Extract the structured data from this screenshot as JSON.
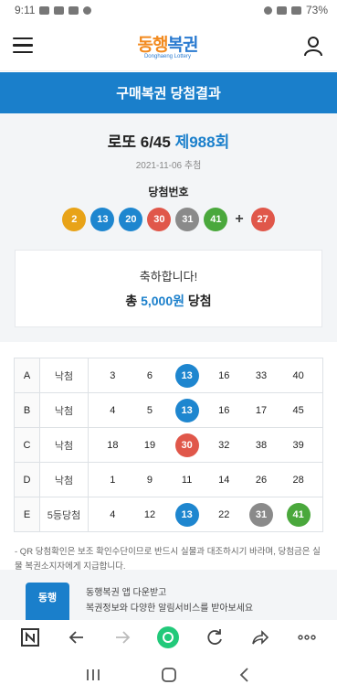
{
  "status": {
    "time": "9:11",
    "battery": "73%"
  },
  "header": {
    "logo_text_a": "동행",
    "logo_text_b": "복권",
    "logo_sub": "Donghaeng Lottery"
  },
  "title": "구매복권 당첨결과",
  "draw": {
    "game": "로또 6/45",
    "round": "제988회",
    "date": "2021-11-06 추첨",
    "win_label": "당첨번호",
    "numbers": [
      "2",
      "13",
      "20",
      "30",
      "31",
      "41"
    ],
    "bonus": "27",
    "ball_colors": [
      "#e8a318",
      "#1e86cf",
      "#1e86cf",
      "#e0574a",
      "#8a8a8a",
      "#4aa83c"
    ],
    "bonus_color": "#e0574a"
  },
  "result": {
    "message": "축하합니다!",
    "prize_prefix": "총",
    "prize_amount": "5,000원",
    "prize_suffix": "당첨"
  },
  "games": [
    {
      "id": "A",
      "result": "낙첨",
      "numbers": [
        "3",
        "6",
        "13",
        "16",
        "33",
        "40"
      ],
      "colors": [
        "",
        "",
        "#1e86cf",
        "",
        "",
        ""
      ]
    },
    {
      "id": "B",
      "result": "낙첨",
      "numbers": [
        "4",
        "5",
        "13",
        "16",
        "17",
        "45"
      ],
      "colors": [
        "",
        "",
        "#1e86cf",
        "",
        "",
        ""
      ]
    },
    {
      "id": "C",
      "result": "낙첨",
      "numbers": [
        "18",
        "19",
        "30",
        "32",
        "38",
        "39"
      ],
      "colors": [
        "",
        "",
        "#e0574a",
        "",
        "",
        ""
      ]
    },
    {
      "id": "D",
      "result": "낙첨",
      "numbers": [
        "1",
        "9",
        "11",
        "14",
        "26",
        "28"
      ],
      "colors": [
        "",
        "",
        "",
        "",
        "",
        ""
      ]
    },
    {
      "id": "E",
      "result": "5등당첨",
      "numbers": [
        "4",
        "12",
        "13",
        "22",
        "31",
        "41"
      ],
      "colors": [
        "",
        "",
        "#1e86cf",
        "",
        "#8a8a8a",
        "#4aa83c"
      ]
    }
  ],
  "note": "- QR 당첨확인은 보조 확인수단이므로 반드시 실물과 대조하시기 바라며, 당첨금은 실물 복권소지자에게 지급합니다.",
  "promo": {
    "line1": "동행복권 앱 다운받고",
    "line2": "복권정보와 다양한 알림서비스를 받아보세요",
    "logo": "동행"
  },
  "browser": {
    "icons": [
      "n-icon",
      "back-arrow-icon",
      "forward-arrow-icon",
      "home-dot-icon",
      "reload-icon",
      "share-icon",
      "more-icon"
    ]
  }
}
